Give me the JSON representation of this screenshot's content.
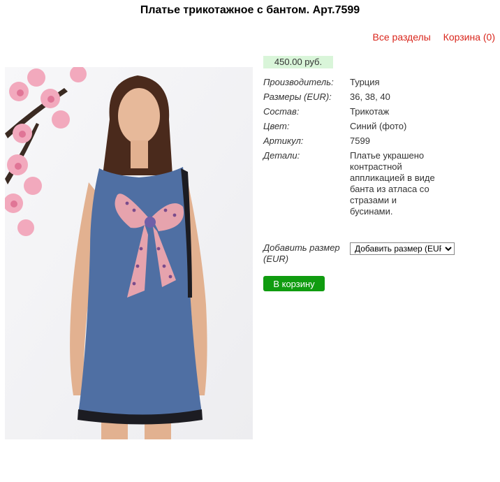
{
  "product": {
    "title": "Платье трикотажное с бантом. Арт.7599",
    "price": "450.00 руб.",
    "image_alt": "Синее платье с бантом из атласа"
  },
  "nav": {
    "all_sections": "Все разделы",
    "cart": "Корзина (0)"
  },
  "specs": [
    {
      "label": "Производитель:",
      "value": "Турция"
    },
    {
      "label": "Размеры (EUR):",
      "value": "36, 38, 40"
    },
    {
      "label": "Состав:",
      "value": "Трикотаж"
    },
    {
      "label": "Цвет:",
      "value": "Синий (фото)"
    },
    {
      "label": "Артикул:",
      "value": "7599"
    },
    {
      "label": "Детали:",
      "value": "Платье украшено контрастной аппликацией в виде банта из атласа со стразами и бусинами."
    }
  ],
  "size_select": {
    "label": "Добавить размер (EUR)",
    "selected": "Добавить размер (EUR)"
  },
  "actions": {
    "add_to_cart": "В корзину"
  },
  "colors": {
    "link": "#d9261c",
    "price_bg": "#d9f5d9",
    "button": "#109c10",
    "dress": "#4f6fa3"
  }
}
